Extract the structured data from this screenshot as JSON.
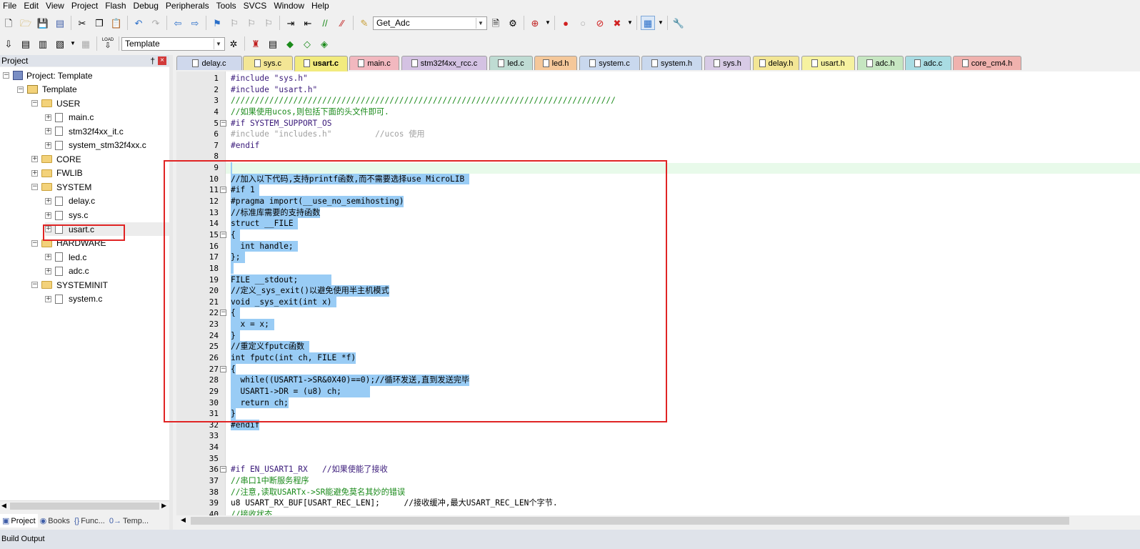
{
  "menu": [
    "File",
    "Edit",
    "View",
    "Project",
    "Flash",
    "Debug",
    "Peripherals",
    "Tools",
    "SVCS",
    "Window",
    "Help"
  ],
  "toolbar1": {
    "function_combo": "Get_Adc"
  },
  "toolbar2": {
    "target_combo": "Template",
    "load_label": "LOAD"
  },
  "project_panel": {
    "title": "Project",
    "pin": "†",
    "close": "×",
    "tree": [
      {
        "label": "Project: Template",
        "kind": "project",
        "level": 0,
        "expander": "−"
      },
      {
        "label": "Template",
        "kind": "target",
        "level": 1,
        "expander": "−"
      },
      {
        "label": "USER",
        "kind": "folder",
        "level": 2,
        "expander": "−"
      },
      {
        "label": "main.c",
        "kind": "file",
        "level": 3,
        "expander": "+"
      },
      {
        "label": "stm32f4xx_it.c",
        "kind": "file",
        "level": 3,
        "expander": "+"
      },
      {
        "label": "system_stm32f4xx.c",
        "kind": "file",
        "level": 3,
        "expander": "+"
      },
      {
        "label": "CORE",
        "kind": "folder",
        "level": 2,
        "expander": "+"
      },
      {
        "label": "FWLIB",
        "kind": "folder",
        "level": 2,
        "expander": "+"
      },
      {
        "label": "SYSTEM",
        "kind": "folder",
        "level": 2,
        "expander": "−"
      },
      {
        "label": "delay.c",
        "kind": "file",
        "level": 3,
        "expander": "+"
      },
      {
        "label": "sys.c",
        "kind": "file",
        "level": 3,
        "expander": "+"
      },
      {
        "label": "usart.c",
        "kind": "file",
        "level": 3,
        "expander": "+"
      },
      {
        "label": "HARDWARE",
        "kind": "folder",
        "level": 2,
        "expander": "−"
      },
      {
        "label": "led.c",
        "kind": "file",
        "level": 3,
        "expander": "+"
      },
      {
        "label": "adc.c",
        "kind": "file",
        "level": 3,
        "expander": "+"
      },
      {
        "label": "SYSTEMINIT",
        "kind": "folder",
        "level": 2,
        "expander": "−"
      },
      {
        "label": "system.c",
        "kind": "file",
        "level": 3,
        "expander": "+"
      }
    ]
  },
  "bottom_tabs": [
    {
      "label": "Project",
      "icon": "▣"
    },
    {
      "label": "Books",
      "icon": "◉"
    },
    {
      "label": "Func...",
      "icon": "{}"
    },
    {
      "label": "Temp...",
      "icon": "0→"
    }
  ],
  "build_output": "Build Output",
  "tabs": [
    {
      "label": "delay.c",
      "color": "#cfd8ec"
    },
    {
      "label": "sys.c",
      "color": "#f3e695"
    },
    {
      "label": "usart.c",
      "color": "#f2eb7e",
      "active": true
    },
    {
      "label": "main.c",
      "color": "#f2b8bf"
    },
    {
      "label": "stm32f4xx_rcc.c",
      "color": "#d4c2e3"
    },
    {
      "label": "led.c",
      "color": "#bfdcd3"
    },
    {
      "label": "led.h",
      "color": "#f5c89a"
    },
    {
      "label": "system.c",
      "color": "#c9d8ee"
    },
    {
      "label": "system.h",
      "color": "#c9d8ee"
    },
    {
      "label": "sys.h",
      "color": "#d8cbe6"
    },
    {
      "label": "delay.h",
      "color": "#f3e695"
    },
    {
      "label": "usart.h",
      "color": "#f6f2a0"
    },
    {
      "label": "adc.h",
      "color": "#c6e6c1"
    },
    {
      "label": "adc.c",
      "color": "#a9dce3"
    },
    {
      "label": "core_cm4.h",
      "color": "#f0b2ae"
    }
  ],
  "code": [
    {
      "n": 1,
      "t": "#include \"sys.h\"",
      "cls": "pp"
    },
    {
      "n": 2,
      "t": "#include \"usart.h\"",
      "cls": "pp"
    },
    {
      "n": 3,
      "t": "////////////////////////////////////////////////////////////////////////////////",
      "cls": "cm"
    },
    {
      "n": 4,
      "t": "//如果使用ucos,则包括下面的头文件即可.",
      "cls": "cm"
    },
    {
      "n": 5,
      "t": "#if SYSTEM_SUPPORT_OS",
      "cls": "pp",
      "fold": "−"
    },
    {
      "n": 6,
      "t": "#include \"includes.h\"         //ucos 使用",
      "cls": "dim"
    },
    {
      "n": 7,
      "t": "#endif",
      "cls": "pp"
    },
    {
      "n": 8,
      "t": ""
    },
    {
      "n": 9,
      "t": "",
      "sel": true,
      "sw": 2
    },
    {
      "n": 10,
      "t": "//加入以下代码,支持printf函数,而不需要选择use MicroLIB ",
      "sel": true
    },
    {
      "n": 11,
      "t": "#if 1 ",
      "sel": true,
      "fold": "−"
    },
    {
      "n": 12,
      "t": "#pragma import(__use_no_semihosting)",
      "sel": true
    },
    {
      "n": 13,
      "t": "//标准库需要的支持函数",
      "sel": true
    },
    {
      "n": 14,
      "t": "struct __FILE ",
      "sel": true
    },
    {
      "n": 15,
      "t": "{ ",
      "sel": true,
      "fold": "−"
    },
    {
      "n": 16,
      "t": "  int handle; ",
      "sel": true
    },
    {
      "n": 17,
      "t": "}; ",
      "sel": true
    },
    {
      "n": 18,
      "t": "",
      "sel": true,
      "sw": 4
    },
    {
      "n": 19,
      "t": "FILE __stdout;       ",
      "sel": true
    },
    {
      "n": 20,
      "t": "//定义_sys_exit()以避免使用半主机模式",
      "sel": true
    },
    {
      "n": 21,
      "t": "void _sys_exit(int x) ",
      "sel": true
    },
    {
      "n": 22,
      "t": "{ ",
      "sel": true,
      "fold": "−"
    },
    {
      "n": 23,
      "t": "  x = x; ",
      "sel": true
    },
    {
      "n": 24,
      "t": "} ",
      "sel": true
    },
    {
      "n": 25,
      "t": "//重定义fputc函数 ",
      "sel": true
    },
    {
      "n": 26,
      "t": "int fputc(int ch, FILE *f)",
      "sel": true
    },
    {
      "n": 27,
      "t": "{",
      "sel": true,
      "fold": "−"
    },
    {
      "n": 28,
      "t": "  while((USART1->SR&0X40)==0);//循环发送,直到发送完毕",
      "sel": true
    },
    {
      "n": 29,
      "t": "  USART1->DR = (u8) ch;      ",
      "sel": true
    },
    {
      "n": 30,
      "t": "  return ch;",
      "sel": true
    },
    {
      "n": 31,
      "t": "}",
      "sel": true
    },
    {
      "n": 32,
      "t": "#endif",
      "sel": true
    },
    {
      "n": 33,
      "t": ""
    },
    {
      "n": 34,
      "t": ""
    },
    {
      "n": 35,
      "t": ""
    },
    {
      "n": 36,
      "t": "#if EN_USART1_RX   //如果使能了接收",
      "cls": "pp",
      "fold": "−"
    },
    {
      "n": 37,
      "t": "//串口1中断服务程序",
      "cls": "cm"
    },
    {
      "n": 38,
      "t": "//注意,读取USARTx->SR能避免莫名其妙的错误",
      "cls": "cm"
    },
    {
      "n": 39,
      "t": "u8 USART_RX_BUF[USART_REC_LEN];     //接收缓冲,最大USART_REC_LEN个字节.",
      "cls": "mix"
    },
    {
      "n": 40,
      "t": "//接收状态",
      "cls": "cm"
    }
  ],
  "colors": {
    "selection": "#99ccf5",
    "current_line": "#e8faea",
    "highlight_box": "#e02424"
  }
}
